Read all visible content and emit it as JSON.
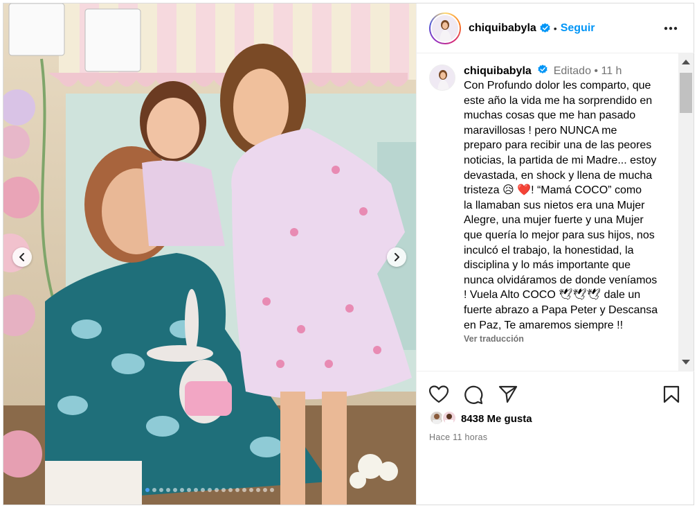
{
  "header": {
    "username": "chiquibabyla",
    "separator": "•",
    "follow_label": "Seguir",
    "more_icon": "more-horizontal-icon"
  },
  "caption": {
    "username": "chiquibabyla",
    "edited_label": "Editado",
    "separator": "•",
    "time": "11 h",
    "lines": [
      "Con Profundo dolor les comparto, que",
      "este año la vida me ha sorprendido en",
      "muchas cosas que me han pasado",
      "maravillosas ! pero NUNCA me",
      "preparo para recibir una de las peores",
      "noticias, la partida de mi Madre... estoy",
      "devastada, en shock y llena de mucha",
      "tristeza 😥 ❤️! “Mamá COCO” como",
      "la llamaban sus nietos era una Mujer",
      "Alegre, una mujer fuerte y una Mujer",
      "que quería lo mejor para sus hijos, nos",
      "inculcó el trabajo, la honestidad, la",
      "disciplina y lo más importante que",
      "nunca olvidáramos de donde veníamos",
      "! Vuela Alto COCO 🕊🕊🕊 dale un",
      "fuerte abrazo a Papa Peter y Descansa",
      "en Paz, Te amaremos siempre !!"
    ],
    "translate_label": "Ver traducción"
  },
  "actions": {
    "like_icon": "heart-icon",
    "comment_icon": "comment-icon",
    "share_icon": "share-icon",
    "save_icon": "bookmark-icon"
  },
  "likes": {
    "count_label": "8438 Me gusta"
  },
  "posted_ago": "Hace 11 horas",
  "carousel": {
    "total_slides": 19,
    "active_index": 0
  },
  "colors": {
    "accent": "#0095f6",
    "verified": "#0095f6",
    "muted_text": "#737373",
    "active_dot": "#4a9ff5"
  }
}
